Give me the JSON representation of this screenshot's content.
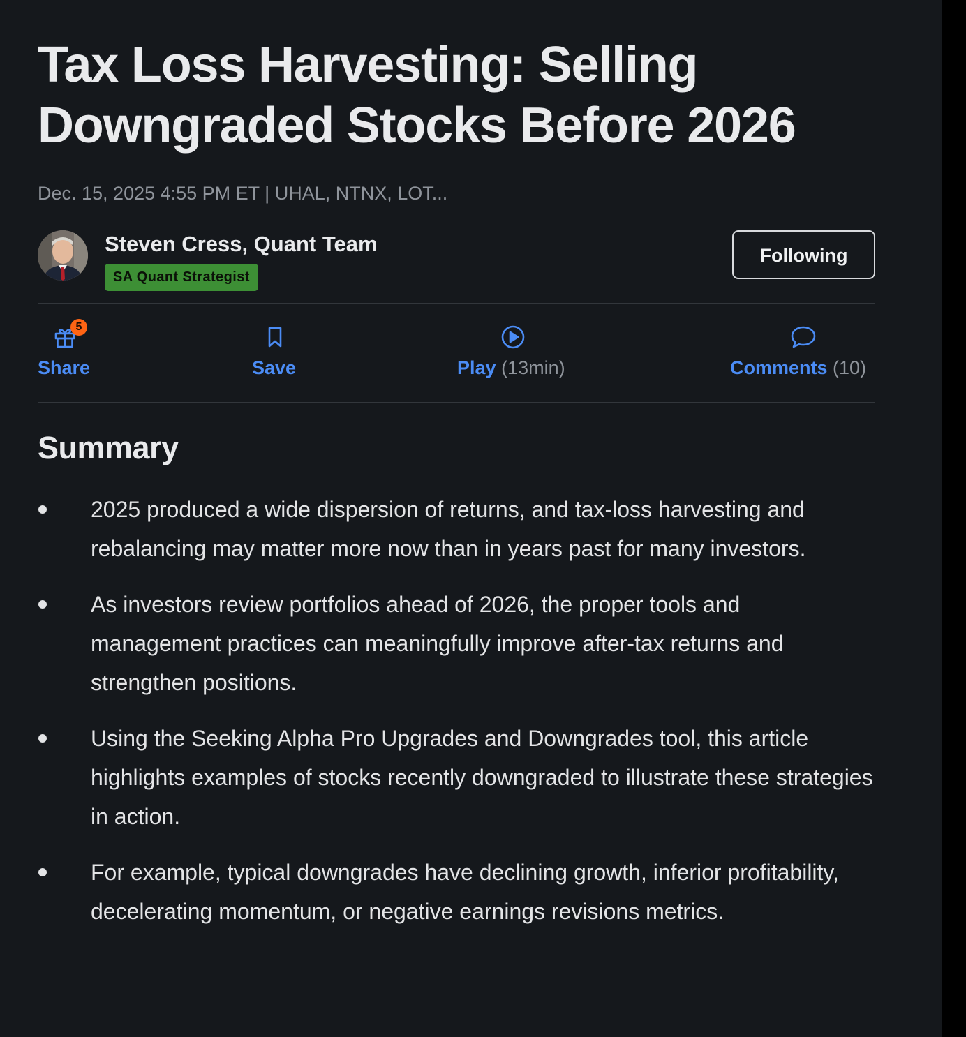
{
  "article": {
    "title": "Tax Loss Harvesting: Selling Downgraded Stocks Before 2026",
    "meta": "Dec. 15, 2025 4:55 PM ET | UHAL, NTNX, LOT..."
  },
  "author": {
    "name": "Steven Cress, Quant Team",
    "badge": "SA Quant Strategist",
    "follow_label": "Following",
    "colors": {
      "badge_bg": "#3d8f35"
    }
  },
  "actions": {
    "share": {
      "label": "Share",
      "badge_count": "5",
      "icon": "gift-icon"
    },
    "save": {
      "label": "Save",
      "icon": "bookmark-icon"
    },
    "play": {
      "label": "Play",
      "count": "(13min)",
      "icon": "play-circle-icon"
    },
    "comments": {
      "label": "Comments",
      "count": "(10)",
      "icon": "speech-bubble-icon"
    }
  },
  "summary": {
    "heading": "Summary",
    "items": [
      "2025 produced a wide dispersion of returns, and tax-loss harvesting and rebalancing may matter more now than in years past for many investors.",
      "As investors review portfolios ahead of 2026, the proper tools and management practices can meaningfully improve after-tax returns and strengthen positions.",
      "Using the Seeking Alpha Pro Upgrades and Downgrades tool, this article highlights examples of stocks recently downgraded to illustrate these strategies in action.",
      "For example, typical downgrades have declining growth, inferior profitability, decelerating momentum, or negative earnings revisions metrics."
    ]
  },
  "theme": {
    "background": "#15181c",
    "accent": "#4b8cf5",
    "notification": "#ff6414"
  }
}
